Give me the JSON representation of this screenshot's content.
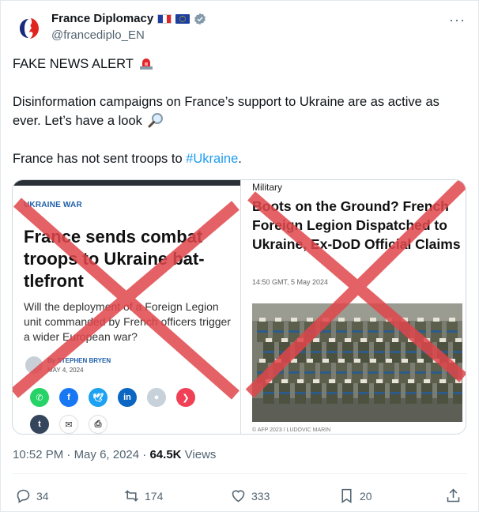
{
  "account": {
    "display_name": "France Diplomacy",
    "handle": "@francediplo_EN"
  },
  "tweet": {
    "line1": "FAKE NEWS ALERT",
    "line2": "Disinformation campaigns on France’s support to Ukraine are as active as ever. Let’s have a look",
    "line3_prefix": "France has not sent troops to ",
    "hashtag": "#Ukraine",
    "line3_suffix": "."
  },
  "media": {
    "left": {
      "kicker": "UKRAINE WAR",
      "headline": "France sends combat troops to Ukraine bat-tlefront",
      "subhead": "Will the deployment of a Foreign Legion unit commanded by French officers trigger a wider European war?",
      "byline": "By STEPHEN BRYEN",
      "date": "MAY 4, 2024",
      "share_buttons": [
        {
          "name": "whatsapp",
          "color": "#25d366",
          "glyph": "✆"
        },
        {
          "name": "facebook",
          "color": "#1877f2",
          "glyph": "f"
        },
        {
          "name": "twitter",
          "color": "#1da1f2",
          "glyph": "🕊"
        },
        {
          "name": "linkedin",
          "color": "#0a66c2",
          "glyph": "in"
        },
        {
          "name": "reddit",
          "color": "#c7d1da",
          "glyph": "●"
        },
        {
          "name": "pocket",
          "color": "#ef4056",
          "glyph": "❯"
        },
        {
          "name": "tumblr",
          "color": "#35465c",
          "glyph": "t"
        },
        {
          "name": "email",
          "color": "#ffffff",
          "glyph": "✉"
        },
        {
          "name": "print",
          "color": "#ffffff",
          "glyph": "⎙"
        }
      ]
    },
    "right": {
      "category": "Military",
      "headline": "Boots on the Ground? French Foreign Legion Dispatched to Ukraine, Ex-DoD Official Claims",
      "timestamp": "14:50 GMT, 5 May 2024",
      "credit": "© AFP 2023 / LUDOVIC MARIN"
    },
    "cross_color": "#e0464b"
  },
  "meta": {
    "time": "10:52 PM",
    "separator": " · ",
    "date": "May 6, 2024",
    "views_count": "64.5K",
    "views_label": " Views"
  },
  "actions": {
    "replies": "34",
    "reposts": "174",
    "likes": "333",
    "bookmarks": "20"
  },
  "colors": {
    "link": "#1d9bf0",
    "muted": "#536471"
  }
}
